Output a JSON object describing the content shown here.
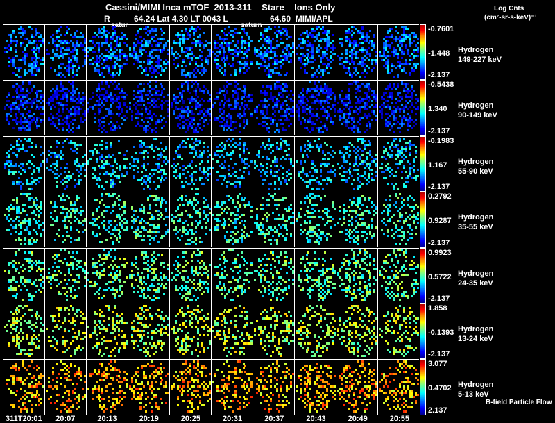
{
  "header": {
    "line1": "Cassini/MIMI Inca mTOF  2013-311    Stare    Ions Only",
    "line2_r": "R",
    "line2_rest": "64.24 Lat 4.30 LT 0043 L",
    "line2_l": "64.60  MIMI/APL",
    "saturn1": "satur",
    "saturn2": "saturn"
  },
  "colorbar_title": {
    "line1": "Log Cnts",
    "line2": "(cm²-sr-s-keV)⁻¹"
  },
  "footer_note": "B-field Particle Flow",
  "chart_data": {
    "type": "heatmap",
    "title": "Cassini/MIMI Inca mTOF 2013-311 Stare Ions Only",
    "time_labels": [
      "311T20:01",
      "20:07",
      "20:13",
      "20:19",
      "20:25",
      "20:31",
      "20:37",
      "20:43",
      "20:49",
      "20:55"
    ],
    "rows": [
      {
        "species": "Hydrogen",
        "energy": "149-227 keV",
        "max": "-0.7601",
        "mid": "-1.448",
        "min": "-2.137",
        "level": 0.25
      },
      {
        "species": "Hydrogen",
        "energy": "90-149 keV",
        "max": "-0.5438",
        "mid": "1.340",
        "min": "-2.137",
        "level": 0.15
      },
      {
        "species": "Hydrogen",
        "energy": "55-90 keV",
        "max": "-0.1983",
        "mid": "1.167",
        "min": "-2.137",
        "level": 0.35
      },
      {
        "species": "Hydrogen",
        "energy": "35-55 keV",
        "max": "0.2792",
        "mid": "0.9287",
        "min": "-2.137",
        "level": 0.45
      },
      {
        "species": "Hydrogen",
        "energy": "24-35 keV",
        "max": "0.9923",
        "mid": "0.5722",
        "min": "-2.137",
        "level": 0.5
      },
      {
        "species": "Hydrogen",
        "energy": "13-24 keV",
        "max": "1.858",
        "mid": "-0.1393",
        "min": "-2.137",
        "level": 0.6
      },
      {
        "species": "Hydrogen",
        "energy": "5-13 keV",
        "max": "3.077",
        "mid": "0.4702",
        "min": "2.137",
        "level": 0.75
      }
    ]
  }
}
